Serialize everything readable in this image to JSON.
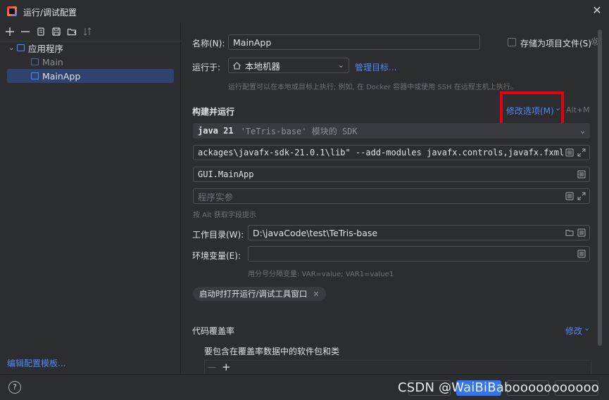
{
  "window": {
    "title": "运行/调试配置",
    "close_glyph": "✕"
  },
  "toolbar": {
    "add": "+",
    "remove": "—",
    "icons": [
      "add-icon",
      "remove-icon",
      "copy-icon",
      "save-icon",
      "folder-icon",
      "sort-icon"
    ]
  },
  "tree": {
    "group_label": "应用程序",
    "items": [
      {
        "label": "Main",
        "selected": false
      },
      {
        "label": "MainApp",
        "selected": true
      }
    ]
  },
  "edit_templates_link": "编辑配置模板...",
  "form": {
    "name_label": "名称(N):",
    "name_value": "MainApp",
    "store_checkbox_label": "存储为项目文件(S)",
    "run_on_label": "运行于:",
    "run_on_value": "本地机器",
    "manage_targets_link": "管理目标...",
    "run_on_hint": "运行配置可以在本地或目标上执行; 例如, 在 Docker 容器中或使用 SSH 在远程主机上执行。",
    "build_run_title": "构建并运行",
    "modify_options_link": "修改选项(M)",
    "modify_options_shortcut": "Alt+M",
    "sdk_main": "java 21",
    "sdk_detail": "'TeTris-base' 模块的 SDK",
    "vm_options": "ackages\\javafx-sdk-21.0.1\\lib\" --add-modules javafx.controls,javafx.fxml",
    "main_class": "GUI.MainApp",
    "program_args_placeholder": "程序实参",
    "alt_hint": "按 Alt 获取字段提示",
    "working_dir_label": "工作目录(W):",
    "working_dir_value": "D:\\javaCode\\test\\TeTris-base",
    "env_label": "环境变量(E):",
    "env_value": "",
    "env_hint": "用分号分隔变量: VAR=value; VAR1=value1",
    "chip_label": "启动时打开运行/调试工具窗口",
    "coverage_title": "代码覆盖率",
    "coverage_modify": "修改",
    "coverage_include_label": "要包含在覆盖率数据中的软件包和类"
  },
  "bottom": {
    "help": "?",
    "watermark": "CSDN @WaiBiBabooooooooooo"
  },
  "colors": {
    "accent": "#548af7",
    "primary_button": "#3574f0",
    "highlight_box": "#e60012",
    "background": "#2b2d30"
  }
}
